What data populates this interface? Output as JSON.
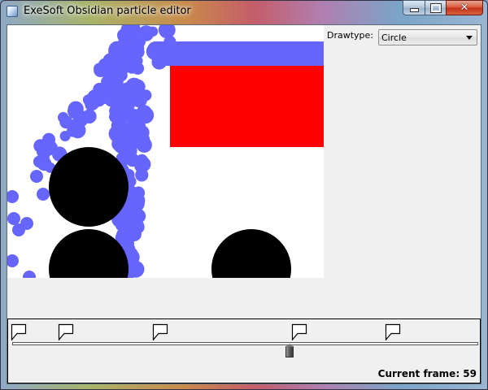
{
  "window": {
    "title": "ExeSoft Obsidian particle editor",
    "buttons": {
      "minimize": "minimize",
      "maximize": "maximize",
      "close": "close"
    }
  },
  "controls": {
    "drawtype_label": "Drawtype:",
    "drawtype_value": "Circle"
  },
  "timeline": {
    "current_frame_label": "Current frame:",
    "current_frame_value": "59",
    "current_frame_text": "Current frame: 59",
    "keyframe_count": 5,
    "position_fraction": 0.595
  },
  "colors": {
    "particle": "#6666ff",
    "red_block": "#ff0000",
    "black_circle": "#000000",
    "canvas_bg": "#ffffff",
    "panel_bg": "#f0f0f0"
  }
}
